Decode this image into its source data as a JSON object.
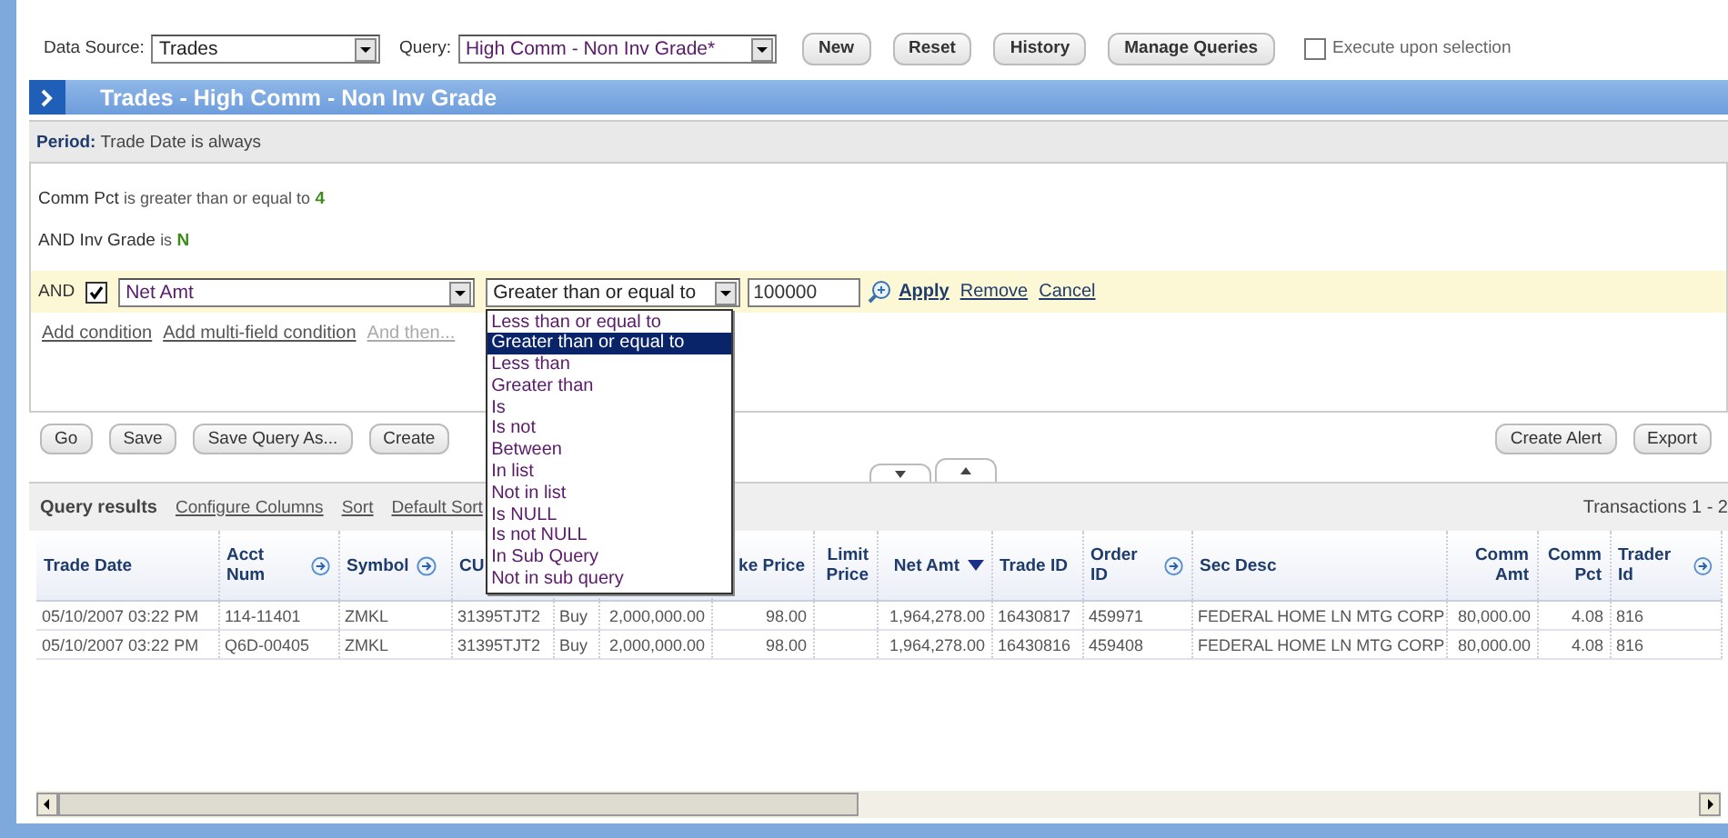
{
  "toolbar": {
    "data_source": {
      "label": "Data Source:",
      "value": "Trades"
    },
    "query": {
      "label": "Query:",
      "value": "High Comm - Non Inv Grade*"
    },
    "buttons": [
      "New",
      "Reset",
      "History",
      "Manage Queries"
    ],
    "execute": {
      "label": "Execute upon selection",
      "checked": false
    }
  },
  "panel": {
    "title": "Trades - High Comm - Non Inv Grade"
  },
  "period": {
    "label": "Period:",
    "text": "Trade Date is always"
  },
  "conditions": [
    {
      "field": "Comm Pct",
      "operator": "is greater than or equal to",
      "value": "4"
    },
    {
      "prefix": "AND",
      "field": "Inv Grade",
      "operator": "is",
      "value": "N"
    }
  ],
  "editor": {
    "conjunction": "AND",
    "checked": true,
    "field": "Net Amt",
    "operator": "Greater than or equal to",
    "value": "100000",
    "links": [
      "Apply",
      "Remove",
      "Cancel"
    ]
  },
  "operator_options": [
    {
      "label": "Less than or equal to",
      "selected": false
    },
    {
      "label": "Greater than or equal to",
      "selected": true
    },
    {
      "label": "Less than",
      "selected": false
    },
    {
      "label": "Greater than",
      "selected": false
    },
    {
      "label": "Is",
      "selected": false
    },
    {
      "label": "Is not",
      "selected": false
    },
    {
      "label": "Between",
      "selected": false
    },
    {
      "label": "In list",
      "selected": false
    },
    {
      "label": "Not in list",
      "selected": false
    },
    {
      "label": "Is NULL",
      "selected": false
    },
    {
      "label": "Is not NULL",
      "selected": false
    },
    {
      "label": "In Sub Query",
      "selected": false
    },
    {
      "label": "Not in sub query",
      "selected": false
    }
  ],
  "add_links": [
    {
      "label": "Add condition",
      "disabled": false
    },
    {
      "label": "Add multi-field condition",
      "disabled": false
    },
    {
      "label": "And then...",
      "disabled": true
    }
  ],
  "actions_left": [
    "Go",
    "Save",
    "Save Query As...",
    "Create"
  ],
  "actions_right": [
    "Create Alert",
    "Export"
  ],
  "results": {
    "title": "Query results",
    "links": [
      "Configure Columns",
      "Sort",
      "Default Sort"
    ],
    "count": "Transactions 1 - 2"
  },
  "table": {
    "columns": [
      {
        "label": "Trade Date",
        "kind": "text",
        "menu_button": false,
        "sorted": false
      },
      {
        "label": "Acct Num",
        "kind": "text",
        "menu_button": true,
        "sorted": false
      },
      {
        "label": "Symbol",
        "kind": "text",
        "menu_button": true,
        "sorted": false
      },
      {
        "label": "CU",
        "kind": "text"
      },
      {
        "kind": "text"
      },
      {
        "kind": "number"
      },
      {
        "label": "ke Price",
        "kind": "number",
        "menu_button": false,
        "sorted": false
      },
      {
        "label": "Limit Price",
        "kind": "number",
        "menu_button": false,
        "sorted": false
      },
      {
        "label": "Net Amt",
        "kind": "number",
        "menu_button": false,
        "sorted": true
      },
      {
        "label": "Trade ID",
        "kind": "text",
        "menu_button": false,
        "sorted": false
      },
      {
        "label": "Order ID",
        "kind": "text",
        "menu_button": true,
        "sorted": false
      },
      {
        "label": "Sec Desc",
        "kind": "text",
        "menu_button": false,
        "sorted": false
      },
      {
        "label": "Comm Amt",
        "kind": "number",
        "menu_button": false,
        "sorted": false
      },
      {
        "label": "Comm Pct",
        "kind": "number",
        "menu_button": false,
        "sorted": false
      },
      {
        "label": "Trader Id",
        "kind": "text",
        "menu_button": true,
        "sorted": false
      }
    ],
    "rows": [
      [
        "05/10/2007 03:22 PM",
        "114-11401",
        "ZMKL",
        "31395TJT2",
        "Buy",
        "2,000,000.00",
        "98.00",
        null,
        "1,964,278.00",
        "16430817",
        "459971",
        "FEDERAL HOME LN MTG CORP",
        "80,000.00",
        "4.08",
        "816"
      ],
      [
        "05/10/2007 03:22 PM",
        "Q6D-00405",
        "ZMKL",
        "31395TJT2",
        "Buy",
        "2,000,000.00",
        "98.00",
        null,
        "1,964,278.00",
        "16430816",
        "459408",
        "FEDERAL HOME LN MTG CORP",
        "80,000.00",
        "4.08",
        "816"
      ]
    ]
  }
}
